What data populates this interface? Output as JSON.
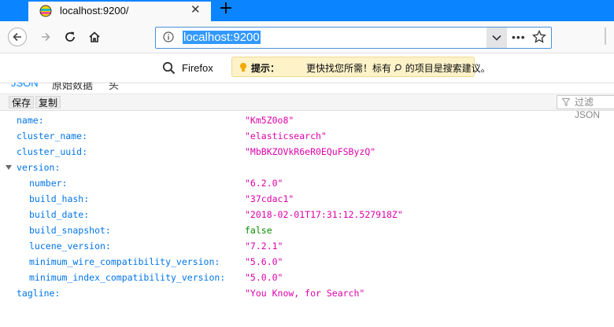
{
  "tab": {
    "title": "localhost:9200/",
    "close": "✕",
    "new_tab": "+"
  },
  "urlbar": {
    "url": "localhost:9200",
    "more": "•••"
  },
  "searchbar": {
    "engine_label": "Firefox",
    "hint_bold": "提示：",
    "hint_text_before": "更快找您所需！标有",
    "hint_text_after": "的项目是搜索建议。"
  },
  "json_viewer": {
    "tabs": [
      "JSON",
      "原始数据",
      "头"
    ],
    "toolbar": {
      "save": "保存",
      "copy": "复制",
      "filter_placeholder": "过滤 JSON"
    },
    "rows": [
      {
        "key": "name:",
        "value": "\"Km5Z0o8\"",
        "type": "string",
        "indent": 0
      },
      {
        "key": "cluster_name:",
        "value": "\"elasticsearch\"",
        "type": "string",
        "indent": 0
      },
      {
        "key": "cluster_uuid:",
        "value": "\"MbBKZOVkR6eR0EQuFSByzQ\"",
        "type": "string",
        "indent": 0
      },
      {
        "key": "version:",
        "value": "",
        "type": "object",
        "indent": 0,
        "expanded": true
      },
      {
        "key": "number:",
        "value": "\"6.2.0\"",
        "type": "string",
        "indent": 1
      },
      {
        "key": "build_hash:",
        "value": "\"37cdac1\"",
        "type": "string",
        "indent": 1
      },
      {
        "key": "build_date:",
        "value": "\"2018-02-01T17:31:12.527918Z\"",
        "type": "string",
        "indent": 1
      },
      {
        "key": "build_snapshot:",
        "value": "false",
        "type": "boolean",
        "indent": 1
      },
      {
        "key": "lucene_version:",
        "value": "\"7.2.1\"",
        "type": "string",
        "indent": 1
      },
      {
        "key": "minimum_wire_compatibility_version:",
        "value": "\"5.6.0\"",
        "type": "string",
        "indent": 1
      },
      {
        "key": "minimum_index_compatibility_version:",
        "value": "\"5.0.0\"",
        "type": "string",
        "indent": 1
      },
      {
        "key": "tagline:",
        "value": "\"You Know, for Search\"",
        "type": "string",
        "indent": 0
      }
    ]
  },
  "colors": {
    "key": "#0074e8",
    "string": "#dd00a9",
    "boolean": "#058b00",
    "accent": "#0a84ff"
  }
}
